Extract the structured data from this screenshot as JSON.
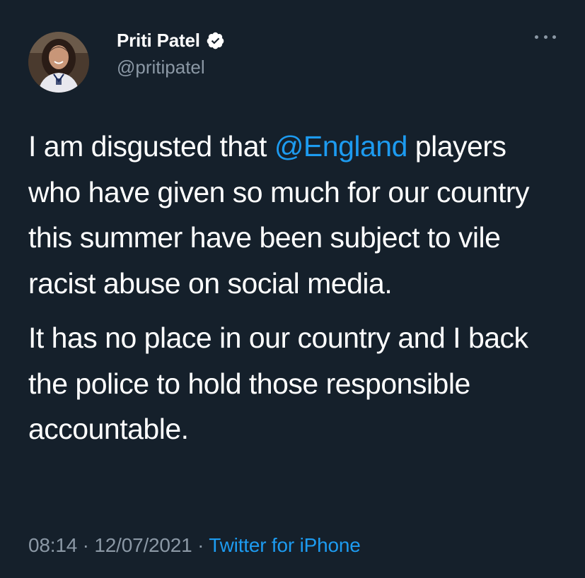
{
  "author": {
    "display_name": "Priti Patel",
    "handle": "@pritipatel",
    "verified": true,
    "avatar": "profile-photo"
  },
  "tweet": {
    "paragraph1": {
      "before": "I am disgusted that ",
      "mention": "@England",
      "after": " players who have given so much for our country this summer have been subject to vile racist abuse on social media."
    },
    "paragraph2": "It has no place in our country and I back the police to hold those responsible accountable."
  },
  "meta": {
    "time": "08:14",
    "separator": " · ",
    "date": "12/07/2021",
    "source": "Twitter for iPhone"
  },
  "icons": {
    "verified": "verified-badge-icon",
    "more": "more-options-icon"
  },
  "colors": {
    "background": "#15202b",
    "text": "#ffffff",
    "secondary": "#8b98a5",
    "link": "#1d9bf0"
  }
}
